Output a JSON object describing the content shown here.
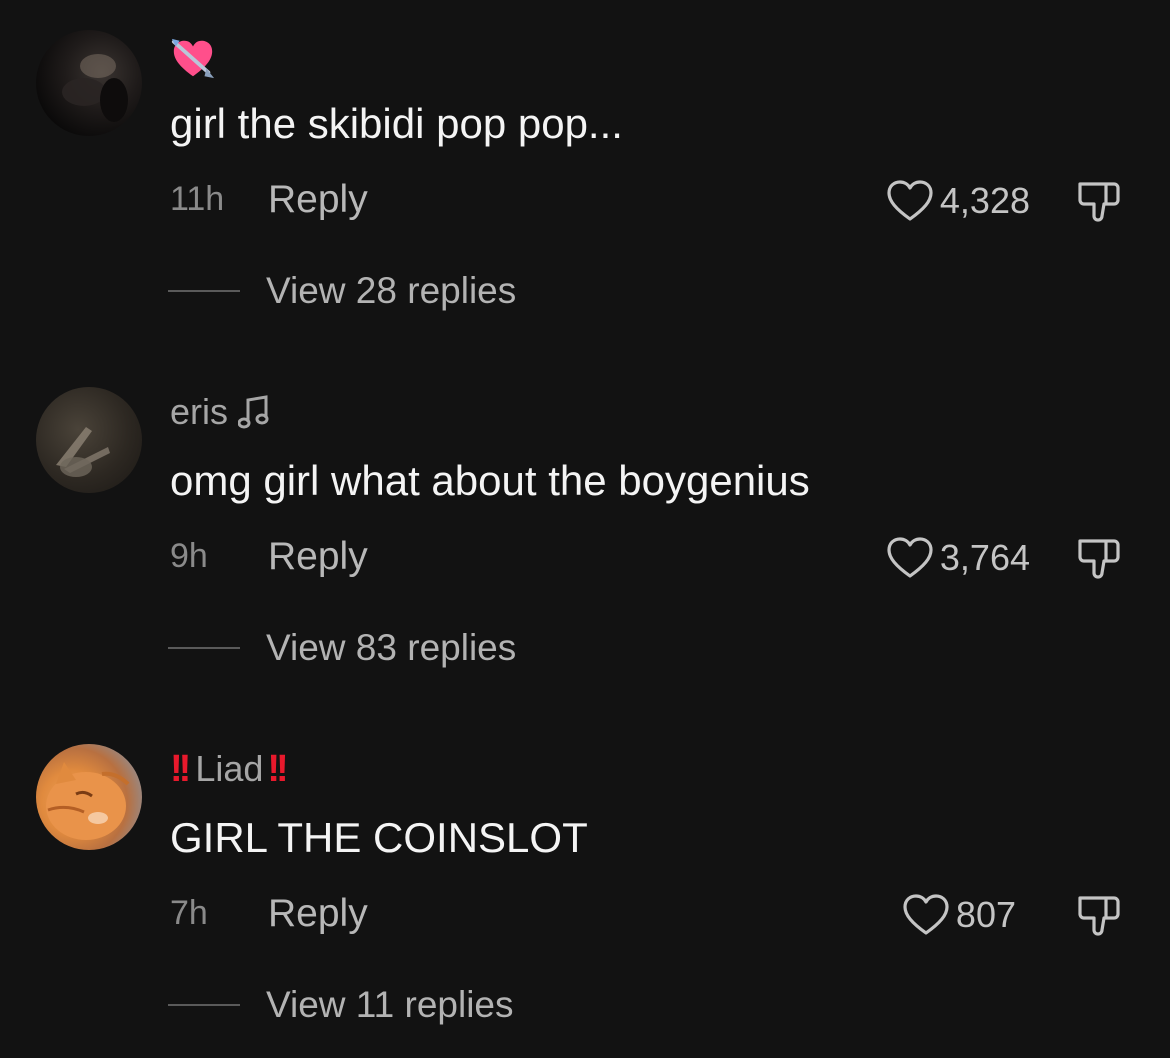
{
  "comments": [
    {
      "username": "",
      "has_heart_emoji": true,
      "text": "girl the skibidi pop pop...",
      "time": "11h",
      "reply_label": "Reply",
      "likes": "4,328",
      "view_replies": "View 28 replies"
    },
    {
      "username": "eris",
      "text": "omg girl what about the boygenius",
      "time": "9h",
      "reply_label": "Reply",
      "likes": "3,764",
      "view_replies": "View 83 replies"
    },
    {
      "username": "Liad",
      "username_prefix": "!!",
      "username_suffix": "!!",
      "text": "GIRL THE COINSLOT",
      "time": "7h",
      "reply_label": "Reply",
      "likes": "807",
      "view_replies": "View 11 replies"
    }
  ],
  "icons": {
    "heart_emoji": "heart-with-arrow-emoji",
    "note": "music-note-icon",
    "like": "heart-outline-icon",
    "dislike": "thumbs-down-icon"
  },
  "colors": {
    "background": "#121212",
    "text_primary": "#f4f4f4",
    "text_secondary": "#a6a6a6",
    "accent_red": "#e8192c",
    "emoji_pink": "#ff4f8b"
  }
}
